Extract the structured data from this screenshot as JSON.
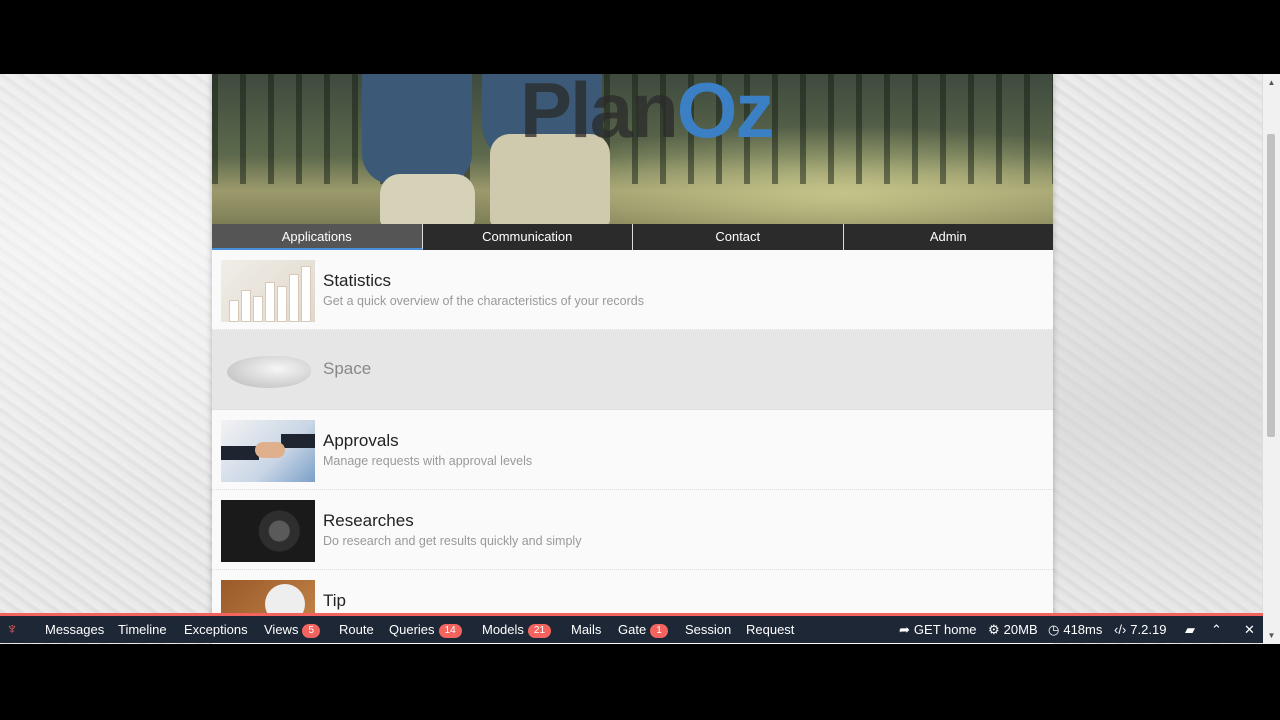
{
  "logo": {
    "part1": "Plan",
    "part2": "Oz"
  },
  "nav": {
    "tabs": [
      {
        "label": "Applications",
        "active": true
      },
      {
        "label": "Communication",
        "active": false
      },
      {
        "label": "Contact",
        "active": false
      },
      {
        "label": "Admin",
        "active": false
      }
    ]
  },
  "apps": [
    {
      "title": "Statistics",
      "desc": "Get a quick overview of the characteristics of your records"
    },
    {
      "title": "Space",
      "desc": ""
    },
    {
      "title": "Approvals",
      "desc": "Manage requests with approval levels"
    },
    {
      "title": "Researches",
      "desc": "Do research and get results quickly and simply"
    },
    {
      "title": "Tip",
      "desc": ""
    }
  ],
  "debugbar": {
    "tabs": [
      {
        "label": "Messages"
      },
      {
        "label": "Timeline"
      },
      {
        "label": "Exceptions"
      },
      {
        "label": "Views",
        "badge": "5"
      },
      {
        "label": "Route"
      },
      {
        "label": "Queries",
        "badge": "14"
      },
      {
        "label": "Models",
        "badge": "21"
      },
      {
        "label": "Mails"
      },
      {
        "label": "Gate",
        "badge": "1"
      },
      {
        "label": "Session"
      },
      {
        "label": "Request"
      }
    ],
    "route": "GET home",
    "memory": "20MB",
    "time": "418ms",
    "version": "7.2.19"
  },
  "colors": {
    "accent": "#3b7fc4",
    "debugbar_bg": "#1d2736",
    "debugbar_accent": "#f4645f"
  }
}
